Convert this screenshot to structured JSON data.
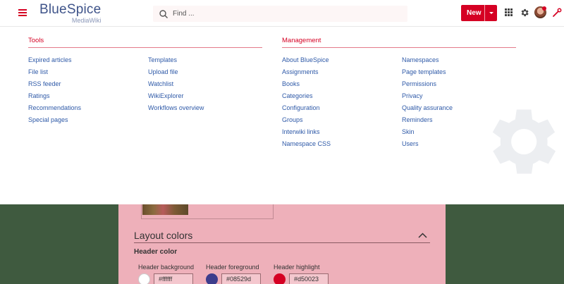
{
  "header": {
    "logo_main": "BlueSpice",
    "logo_sub": "MediaWiki",
    "search_placeholder": "Find ...",
    "new_label": "New"
  },
  "menu": {
    "tools": {
      "title": "Tools",
      "col1": [
        "Expired articles",
        "File list",
        "RSS feeder",
        "Ratings",
        "Recommendations",
        "Special pages"
      ],
      "col2": [
        "Templates",
        "Upload file",
        "Watchlist",
        "WikiExplorer",
        "Workflows overview"
      ]
    },
    "management": {
      "title": "Management",
      "col1": [
        "About BlueSpice",
        "Assignments",
        "Books",
        "Categories",
        "Configuration",
        "Groups",
        "Interwiki links",
        "Namespace CSS"
      ],
      "col2": [
        "Namespaces",
        "Page templates",
        "Permissions",
        "Privacy",
        "Quality assurance",
        "Reminders",
        "Skin",
        "Users"
      ]
    }
  },
  "content": {
    "section_title": "Layout colors",
    "subsection_title": "Header color",
    "fields": [
      {
        "label": "Header background",
        "value": "#ffffff",
        "color": "#ffffff"
      },
      {
        "label": "Header foreground",
        "value": "#08529d",
        "color": "#3d3d8c"
      },
      {
        "label": "Header highlight",
        "value": "#d50023",
        "color": "#d50023"
      }
    ]
  },
  "colors": {
    "accent": "#d50023",
    "link": "#2f5aa8",
    "page_background": "#3f5a3f",
    "panel": "#eeb0ba"
  }
}
